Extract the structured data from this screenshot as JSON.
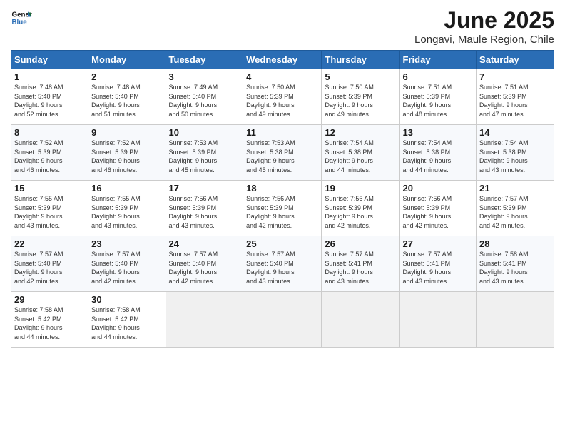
{
  "logo": {
    "line1": "General",
    "line2": "Blue"
  },
  "title": "June 2025",
  "subtitle": "Longavi, Maule Region, Chile",
  "weekdays": [
    "Sunday",
    "Monday",
    "Tuesday",
    "Wednesday",
    "Thursday",
    "Friday",
    "Saturday"
  ],
  "weeks": [
    [
      {
        "day": "1",
        "info": "Sunrise: 7:48 AM\nSunset: 5:40 PM\nDaylight: 9 hours\nand 52 minutes."
      },
      {
        "day": "2",
        "info": "Sunrise: 7:48 AM\nSunset: 5:40 PM\nDaylight: 9 hours\nand 51 minutes."
      },
      {
        "day": "3",
        "info": "Sunrise: 7:49 AM\nSunset: 5:40 PM\nDaylight: 9 hours\nand 50 minutes."
      },
      {
        "day": "4",
        "info": "Sunrise: 7:50 AM\nSunset: 5:39 PM\nDaylight: 9 hours\nand 49 minutes."
      },
      {
        "day": "5",
        "info": "Sunrise: 7:50 AM\nSunset: 5:39 PM\nDaylight: 9 hours\nand 49 minutes."
      },
      {
        "day": "6",
        "info": "Sunrise: 7:51 AM\nSunset: 5:39 PM\nDaylight: 9 hours\nand 48 minutes."
      },
      {
        "day": "7",
        "info": "Sunrise: 7:51 AM\nSunset: 5:39 PM\nDaylight: 9 hours\nand 47 minutes."
      }
    ],
    [
      {
        "day": "8",
        "info": "Sunrise: 7:52 AM\nSunset: 5:39 PM\nDaylight: 9 hours\nand 46 minutes."
      },
      {
        "day": "9",
        "info": "Sunrise: 7:52 AM\nSunset: 5:39 PM\nDaylight: 9 hours\nand 46 minutes."
      },
      {
        "day": "10",
        "info": "Sunrise: 7:53 AM\nSunset: 5:39 PM\nDaylight: 9 hours\nand 45 minutes."
      },
      {
        "day": "11",
        "info": "Sunrise: 7:53 AM\nSunset: 5:38 PM\nDaylight: 9 hours\nand 45 minutes."
      },
      {
        "day": "12",
        "info": "Sunrise: 7:54 AM\nSunset: 5:38 PM\nDaylight: 9 hours\nand 44 minutes."
      },
      {
        "day": "13",
        "info": "Sunrise: 7:54 AM\nSunset: 5:38 PM\nDaylight: 9 hours\nand 44 minutes."
      },
      {
        "day": "14",
        "info": "Sunrise: 7:54 AM\nSunset: 5:38 PM\nDaylight: 9 hours\nand 43 minutes."
      }
    ],
    [
      {
        "day": "15",
        "info": "Sunrise: 7:55 AM\nSunset: 5:39 PM\nDaylight: 9 hours\nand 43 minutes."
      },
      {
        "day": "16",
        "info": "Sunrise: 7:55 AM\nSunset: 5:39 PM\nDaylight: 9 hours\nand 43 minutes."
      },
      {
        "day": "17",
        "info": "Sunrise: 7:56 AM\nSunset: 5:39 PM\nDaylight: 9 hours\nand 43 minutes."
      },
      {
        "day": "18",
        "info": "Sunrise: 7:56 AM\nSunset: 5:39 PM\nDaylight: 9 hours\nand 42 minutes."
      },
      {
        "day": "19",
        "info": "Sunrise: 7:56 AM\nSunset: 5:39 PM\nDaylight: 9 hours\nand 42 minutes."
      },
      {
        "day": "20",
        "info": "Sunrise: 7:56 AM\nSunset: 5:39 PM\nDaylight: 9 hours\nand 42 minutes."
      },
      {
        "day": "21",
        "info": "Sunrise: 7:57 AM\nSunset: 5:39 PM\nDaylight: 9 hours\nand 42 minutes."
      }
    ],
    [
      {
        "day": "22",
        "info": "Sunrise: 7:57 AM\nSunset: 5:40 PM\nDaylight: 9 hours\nand 42 minutes."
      },
      {
        "day": "23",
        "info": "Sunrise: 7:57 AM\nSunset: 5:40 PM\nDaylight: 9 hours\nand 42 minutes."
      },
      {
        "day": "24",
        "info": "Sunrise: 7:57 AM\nSunset: 5:40 PM\nDaylight: 9 hours\nand 42 minutes."
      },
      {
        "day": "25",
        "info": "Sunrise: 7:57 AM\nSunset: 5:40 PM\nDaylight: 9 hours\nand 43 minutes."
      },
      {
        "day": "26",
        "info": "Sunrise: 7:57 AM\nSunset: 5:41 PM\nDaylight: 9 hours\nand 43 minutes."
      },
      {
        "day": "27",
        "info": "Sunrise: 7:57 AM\nSunset: 5:41 PM\nDaylight: 9 hours\nand 43 minutes."
      },
      {
        "day": "28",
        "info": "Sunrise: 7:58 AM\nSunset: 5:41 PM\nDaylight: 9 hours\nand 43 minutes."
      }
    ],
    [
      {
        "day": "29",
        "info": "Sunrise: 7:58 AM\nSunset: 5:42 PM\nDaylight: 9 hours\nand 44 minutes."
      },
      {
        "day": "30",
        "info": "Sunrise: 7:58 AM\nSunset: 5:42 PM\nDaylight: 9 hours\nand 44 minutes."
      },
      null,
      null,
      null,
      null,
      null
    ]
  ]
}
